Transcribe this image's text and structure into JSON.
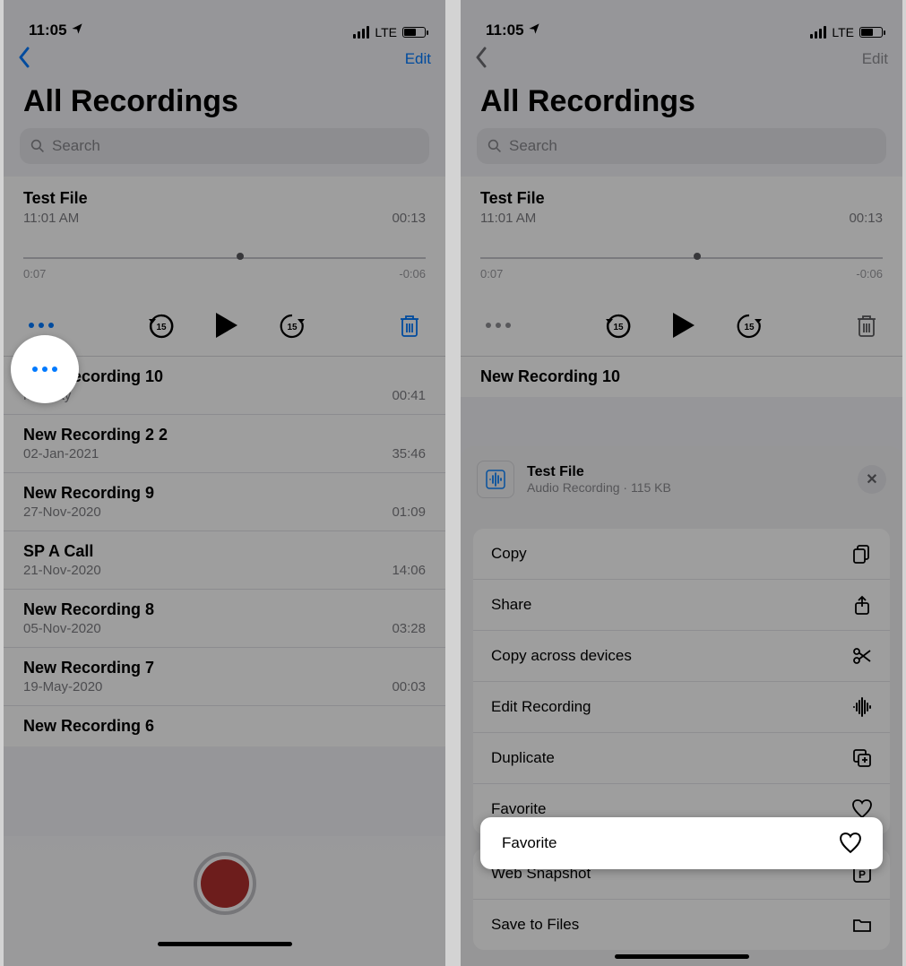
{
  "status": {
    "time": "11:05",
    "network": "LTE"
  },
  "nav": {
    "edit": "Edit"
  },
  "page_title": "All Recordings",
  "search_placeholder": "Search",
  "expanded": {
    "title": "Test File",
    "time": "11:01 AM",
    "duration": "00:13",
    "pos_left": "0:07",
    "pos_right": "-0:06",
    "skip_amount": "15"
  },
  "left_rows": [
    {
      "title": "New Recording 10",
      "sub": "Monday",
      "dur": "00:41"
    },
    {
      "title": "New Recording 2 2",
      "sub": "02-Jan-2021",
      "dur": "35:46"
    },
    {
      "title": "New Recording 9",
      "sub": "27-Nov-2020",
      "dur": "01:09"
    },
    {
      "title": "SP A Call",
      "sub": "21-Nov-2020",
      "dur": "14:06"
    },
    {
      "title": "New Recording 8",
      "sub": "05-Nov-2020",
      "dur": "03:28"
    },
    {
      "title": "New Recording 7",
      "sub": "19-May-2020",
      "dur": "00:03"
    },
    {
      "title": "New Recording 6",
      "sub": "",
      "dur": ""
    }
  ],
  "right_rows": [
    {
      "title": "New Recording 10",
      "sub": "",
      "dur": ""
    }
  ],
  "sheet": {
    "file_title": "Test File",
    "file_sub": "Audio Recording · 115 KB",
    "items": [
      {
        "label": "Copy",
        "icon": "copy"
      },
      {
        "label": "Share",
        "icon": "share"
      },
      {
        "label": "Copy across devices",
        "icon": "scissors"
      },
      {
        "label": "Edit Recording",
        "icon": "waveform"
      },
      {
        "label": "Duplicate",
        "icon": "duplicate"
      },
      {
        "label": "Favorite",
        "icon": "heart"
      },
      {
        "label": "Web Snapshot",
        "icon": "snapshot"
      },
      {
        "label": "Save to Files",
        "icon": "folder"
      }
    ]
  }
}
